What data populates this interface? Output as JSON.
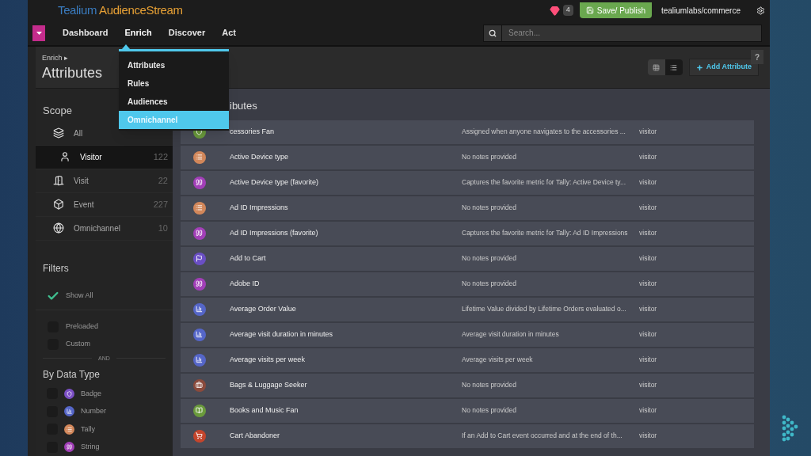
{
  "header": {
    "logo": {
      "part1": "Tealium",
      "part2": "AudienceStream"
    },
    "alerts": "4",
    "publish_button": "Save/ Publish",
    "account": "tealiumlabs/commerce"
  },
  "nav": {
    "tabs": [
      {
        "label": "Dashboard",
        "selected": false
      },
      {
        "label": "Enrich",
        "selected": true
      },
      {
        "label": "Discover",
        "selected": false
      },
      {
        "label": "Act",
        "selected": false
      }
    ],
    "search": {
      "placeholder": "Search..."
    }
  },
  "menu": [
    {
      "label": "Attributes",
      "selected": false
    },
    {
      "label": "Rules",
      "selected": false
    },
    {
      "label": "Audiences",
      "selected": false
    },
    {
      "label": "Omnichannel",
      "selected": true
    }
  ],
  "breadcrumb": "Enrich ▸",
  "page_title": "Attributes",
  "view_toggle": [
    {
      "kind": "grid",
      "selected": false
    },
    {
      "kind": "list",
      "selected": true
    }
  ],
  "add_button": "Add Attribute",
  "help": "?",
  "sidebar": {
    "scope_title": "Scope",
    "scope": [
      {
        "kind": "layers",
        "label": "All",
        "selected": false
      },
      {
        "kind": "person",
        "label": "Visitor",
        "count": "122",
        "selected": true
      },
      {
        "kind": "door",
        "label": "Visit",
        "count": "22",
        "selected": false
      },
      {
        "kind": "cube",
        "label": "Event",
        "count": "227",
        "selected": false
      },
      {
        "kind": "globe",
        "label": "Omnichannel",
        "count": "10",
        "selected": false
      }
    ],
    "filters_title": "Filters",
    "filters": [
      {
        "label": "Show All",
        "checked": true
      },
      {
        "label": "Preloaded",
        "checked": false
      },
      {
        "label": "Custom",
        "checked": false
      }
    ],
    "separator": "AND",
    "types_title": "By Data Type",
    "types": [
      {
        "kind": "badge",
        "label": "Badge",
        "color": "#7b4fc4",
        "checked": false
      },
      {
        "kind": "chart",
        "label": "Number",
        "color": "#5566c8",
        "checked": false
      },
      {
        "kind": "list",
        "label": "Tally",
        "color": "#d2875a",
        "checked": false
      },
      {
        "kind": "quote",
        "label": "String",
        "color": "#a23fb8",
        "checked": false
      }
    ]
  },
  "content": {
    "title": "ibutes",
    "rows": [
      {
        "kind": "badge",
        "color": "#6a9a3c",
        "name": "cessories Fan",
        "notes": "Assigned when anyone navigates to the accessories ...",
        "scope": "visitor"
      },
      {
        "kind": "list",
        "color": "#d2875a",
        "name": "Active Device type",
        "notes": "No notes provided",
        "scope": "visitor"
      },
      {
        "kind": "quote",
        "color": "#a23fb8",
        "name": "Active Device type (favorite)",
        "notes": "Captures the favorite metric for Tally: Active Device ty...",
        "scope": "visitor"
      },
      {
        "kind": "list",
        "color": "#d2875a",
        "name": "Ad ID Impressions",
        "notes": "No notes provided",
        "scope": "visitor"
      },
      {
        "kind": "quote",
        "color": "#a23fb8",
        "name": "Ad ID Impressions (favorite)",
        "notes": "Captures the favorite metric for Tally: Ad ID Impressions",
        "scope": "visitor"
      },
      {
        "kind": "flag",
        "color": "#6a4fc4",
        "name": "Add to Cart",
        "notes": "No notes provided",
        "scope": "visitor"
      },
      {
        "kind": "quote",
        "color": "#a23fb8",
        "name": "Adobe ID",
        "notes": "No notes provided",
        "scope": "visitor"
      },
      {
        "kind": "chart",
        "color": "#5566c8",
        "name": "Average Order Value",
        "notes": "Lifetime Value divided by Lifetime Orders evaluated o...",
        "scope": "visitor"
      },
      {
        "kind": "chart",
        "color": "#5566c8",
        "name": "Average visit duration in minutes",
        "notes": "Average visit duration in minutes",
        "scope": "visitor"
      },
      {
        "kind": "chart",
        "color": "#5566c8",
        "name": "Average visits per week",
        "notes": "Average visits per week",
        "scope": "visitor"
      },
      {
        "kind": "briefcase",
        "color": "#8a4a3c",
        "name": "Bags & Luggage Seeker",
        "notes": "No notes provided",
        "scope": "visitor"
      },
      {
        "kind": "book",
        "color": "#6a9a3c",
        "name": "Books and Music Fan",
        "notes": "No notes provided",
        "scope": "visitor"
      },
      {
        "kind": "cart",
        "color": "#c4452c",
        "name": "Cart Abandoner",
        "notes": "If an Add to Cart event occurred and at the end of th...",
        "scope": "visitor"
      }
    ]
  }
}
